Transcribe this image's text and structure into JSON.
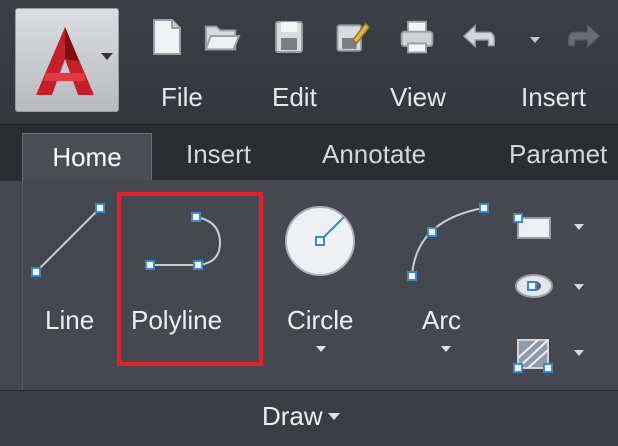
{
  "menu": [
    "File",
    "Edit",
    "View",
    "Insert"
  ],
  "tabs": [
    "Home",
    "Insert",
    "Annotate",
    "Paramet"
  ],
  "commands": {
    "line": "Line",
    "polyline": "Polyline",
    "circle": "Circle",
    "arc": "Arc"
  },
  "panel": {
    "title": "Draw"
  },
  "colors": {
    "highlight": "#e5202a",
    "accent_blue": "#3a86d8",
    "logo_red": "#c41f2a"
  },
  "icons": {
    "app": "autocad-logo-icon",
    "qat": [
      "new-file-icon",
      "open-folder-icon",
      "save-icon",
      "save-as-icon",
      "print-icon",
      "undo-icon",
      "redo-icon"
    ]
  }
}
